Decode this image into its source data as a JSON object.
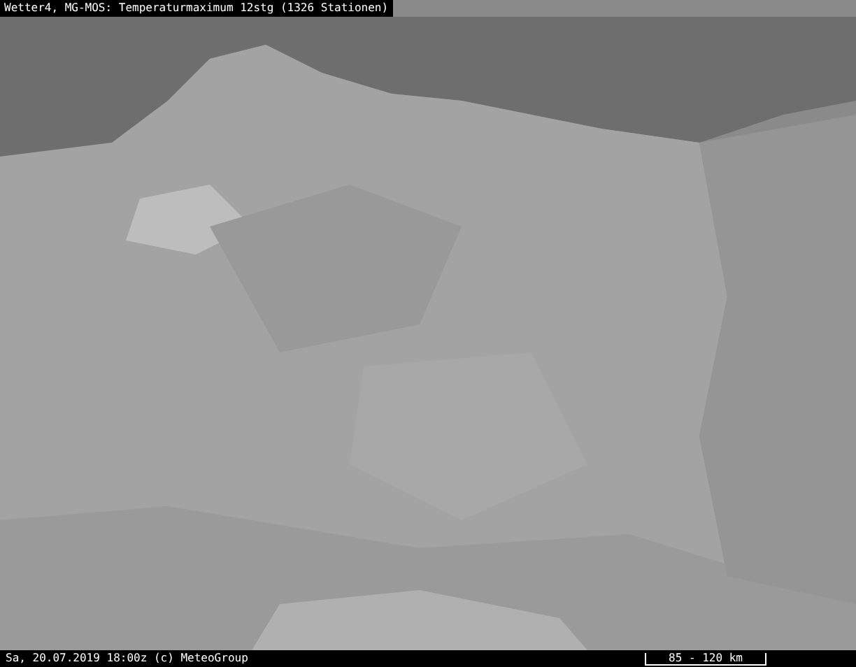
{
  "header": {
    "title": "Wetter4, MG-MOS: Temperaturmaximum 12stg (1326 Stationen)"
  },
  "footer": {
    "timestamp": "Sa, 20.07.2019 18:00z (c) MeteoGroup",
    "scale": "85 - 120 km"
  }
}
